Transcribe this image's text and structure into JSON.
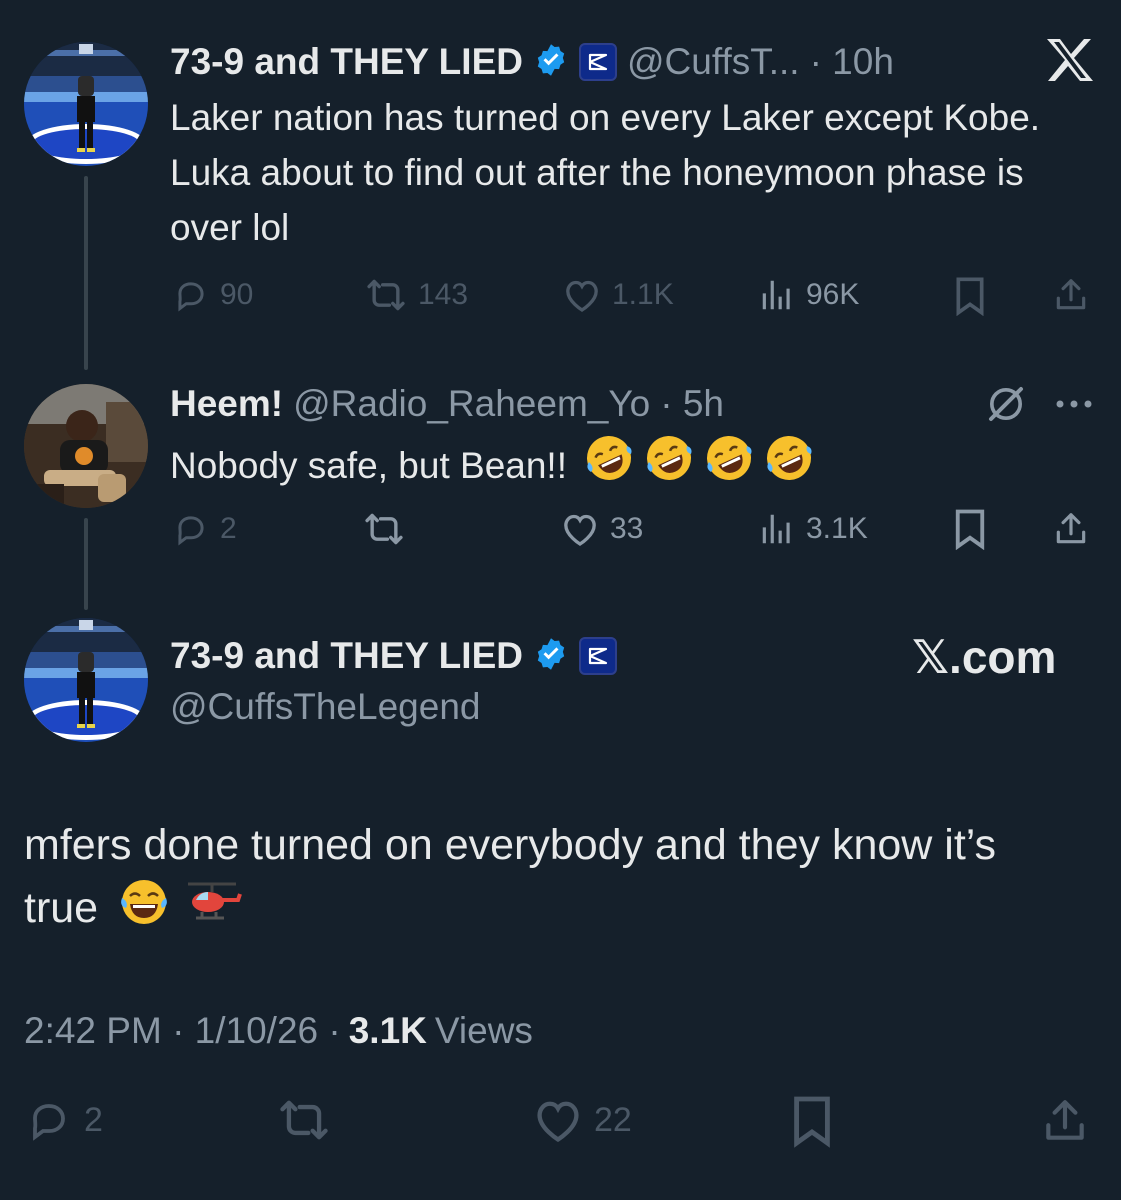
{
  "colors": {
    "background": "#15202b",
    "text": "#e7e9ea",
    "secondary": "#8b98a5",
    "verified": "#1d9bf0"
  },
  "tweet1": {
    "name": "73-9 and THEY LIED",
    "handle": "@CuffsT...",
    "time": "· 10h",
    "text": "Laker nation has turned on every Laker except Kobe. Luka about to find out after the honeymoon phase is over lol",
    "replies": "90",
    "reposts": "143",
    "likes": "1.1K",
    "views": "96K",
    "corner_icon": "x-logo-icon"
  },
  "tweet2": {
    "name": "Heem!",
    "handle": "@Radio_Raheem_Yo",
    "time": "· 5h",
    "text": "Nobody safe, but Bean!!",
    "emoji": [
      "rolling-on-floor-laughing",
      "rolling-on-floor-laughing",
      "rolling-on-floor-laughing",
      "rolling-on-floor-laughing"
    ],
    "replies": "2",
    "likes": "33",
    "views": "3.1K"
  },
  "tweet3": {
    "name": "73-9 and THEY LIED",
    "handle": "@CuffsTheLegend",
    "watermark": "𝕏.com",
    "text": "mfers done turned on everybody and they know it’s true",
    "emoji": [
      "face-with-tears-of-joy",
      "helicopter"
    ],
    "timestamp": "2:42 PM · 1/10/26 ·",
    "views_count": "3.1K",
    "views_label": "Views",
    "replies": "2",
    "likes": "22"
  }
}
